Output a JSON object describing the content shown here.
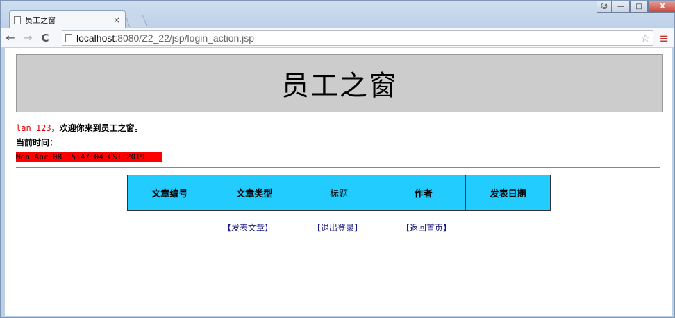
{
  "browser": {
    "tab_title": "员工之窗",
    "tab_close": "×",
    "url_host": "localhost",
    "url_rest": ":8080/Z2_22/jsp/login_action.jsp",
    "back": "←",
    "forward": "→",
    "reload": "C",
    "star": "☆",
    "menu": "≡",
    "window_buttons": {
      "user": "☺",
      "minimize": "—",
      "maximize": "□",
      "close": "X"
    }
  },
  "page": {
    "header_title": "员工之窗",
    "welcome_user": "lan 123",
    "welcome_message": "，欢迎你来到员工之窗。",
    "time_label": "当前时间：",
    "time_value": "Mon Apr 08 15:47:04 CST 2019",
    "table_headers": [
      "文章编号",
      "文章类型",
      "标题",
      "作者",
      "发表日期"
    ],
    "links": [
      "【发表文章】",
      "【退出登录】",
      "【返回首页】"
    ]
  },
  "colors": {
    "header_bg": "#cccccc",
    "table_bg": "#22ccff",
    "time_bg": "#ff0000",
    "user_color": "#e00000",
    "link_color": "#1a1a7e"
  },
  "icons": [
    "page-icon",
    "back-arrow-icon",
    "forward-arrow-icon",
    "reload-icon",
    "star-icon",
    "menu-icon",
    "close-icon"
  ]
}
